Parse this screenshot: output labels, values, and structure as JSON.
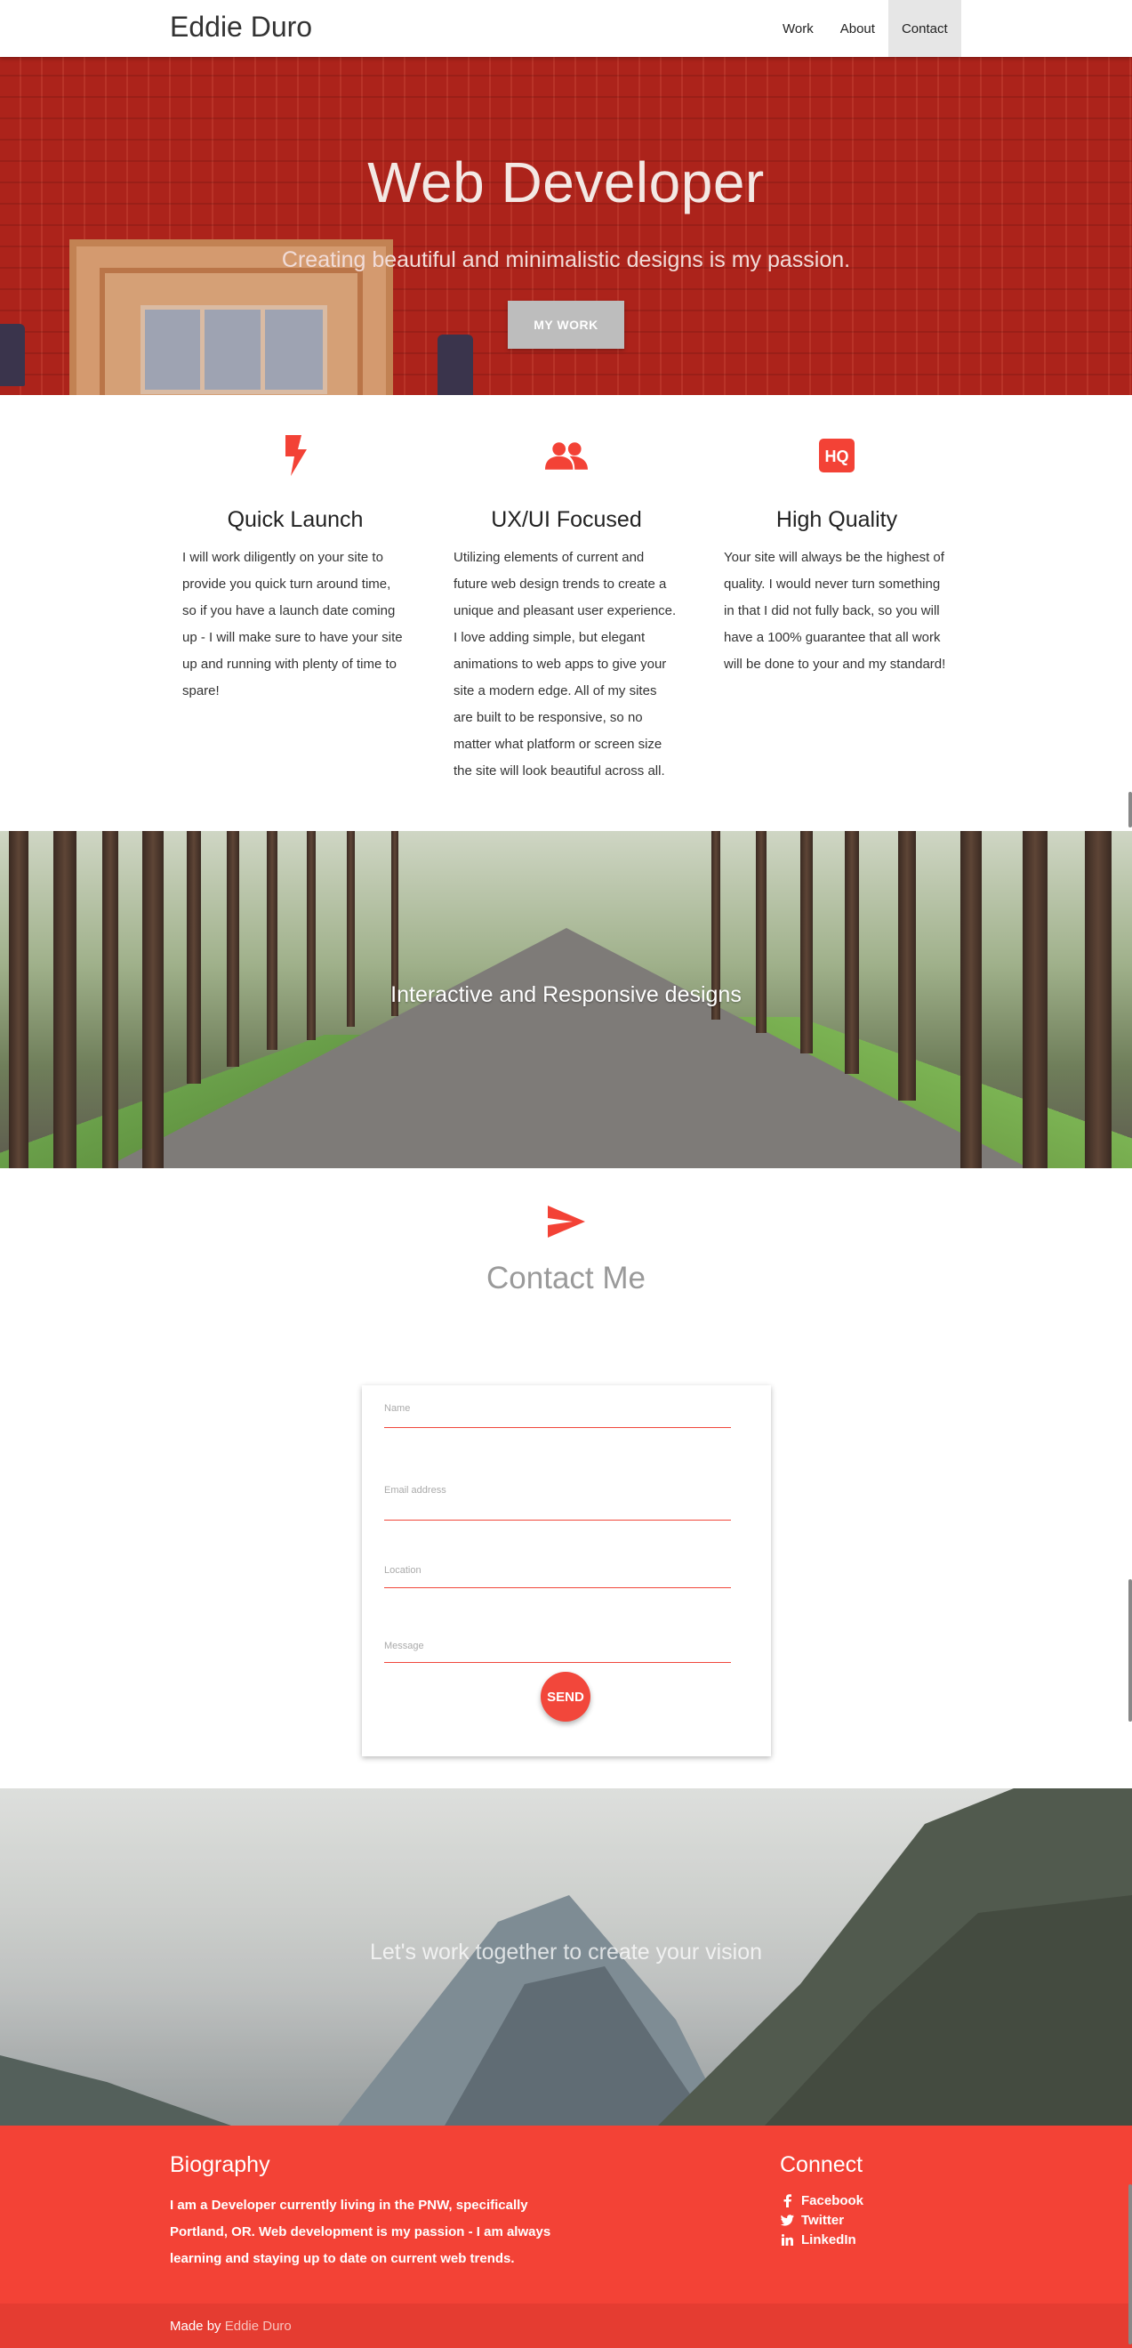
{
  "nav": {
    "brand": "Eddie Duro",
    "links": [
      "Work",
      "About",
      "Contact"
    ]
  },
  "hero": {
    "title": "Web Developer",
    "subtitle": "Creating beautiful and minimalistic designs is my passion.",
    "button": "MY WORK"
  },
  "features": [
    {
      "icon": "flash-icon",
      "title": "Quick Launch",
      "text": "I will work diligently on your site to provide you quick turn around time, so if you have a launch date coming up - I will make sure to have your site up and running with plenty of time to spare!"
    },
    {
      "icon": "group-icon",
      "title": "UX/UI Focused",
      "text": "Utilizing elements of current and future web design trends to create a unique and pleasant user experience. I love adding simple, but elegant animations to web apps to give your site a modern edge. All of my sites are built to be responsive, so no matter what platform or screen size the site will look beautiful across all."
    },
    {
      "icon": "hq-icon",
      "title": "High Quality",
      "text": "Your site will always be the highest of quality. I would never turn something in that I did not fully back, so you will have a 100% guarantee that all work will be done to your and my standard!"
    }
  ],
  "parallax1": {
    "text": "Interactive and Responsive designs"
  },
  "contact": {
    "title": "Contact Me",
    "fields": [
      "Name",
      "Email address",
      "Location",
      "Message"
    ],
    "send": "SEND"
  },
  "parallax2": {
    "text": "Let's work together to create your vision"
  },
  "footer": {
    "bio_title": "Biography",
    "bio_text": "I am a Developer currently living in the PNW, specifically Portland, OR. Web development is my passion - I am always learning and staying up to date on current web trends.",
    "connect_title": "Connect",
    "links": [
      "Facebook",
      "Twitter",
      "LinkedIn"
    ],
    "made_by_prefix": "Made by",
    "made_by_name": "Eddie Duro"
  },
  "colors": {
    "accent": "#f34236",
    "nav_active": "#e6e6e6"
  }
}
